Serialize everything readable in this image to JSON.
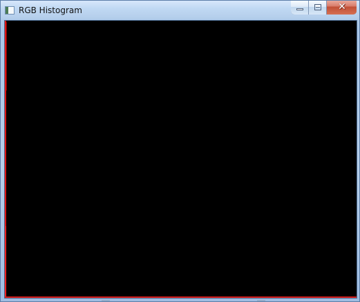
{
  "window": {
    "title": "RGB Histogram"
  },
  "icons": {
    "app": "histogram-window-icon",
    "minimize": "minimize-icon",
    "maximize": "maximize-icon",
    "close": "close-icon"
  },
  "controls": {
    "close_glyph": "✕"
  },
  "colors": {
    "canvas_background": "#000000",
    "red_channel": "#e01616",
    "titlebar": "#c0d8f3",
    "close_button": "#c04f36"
  }
}
